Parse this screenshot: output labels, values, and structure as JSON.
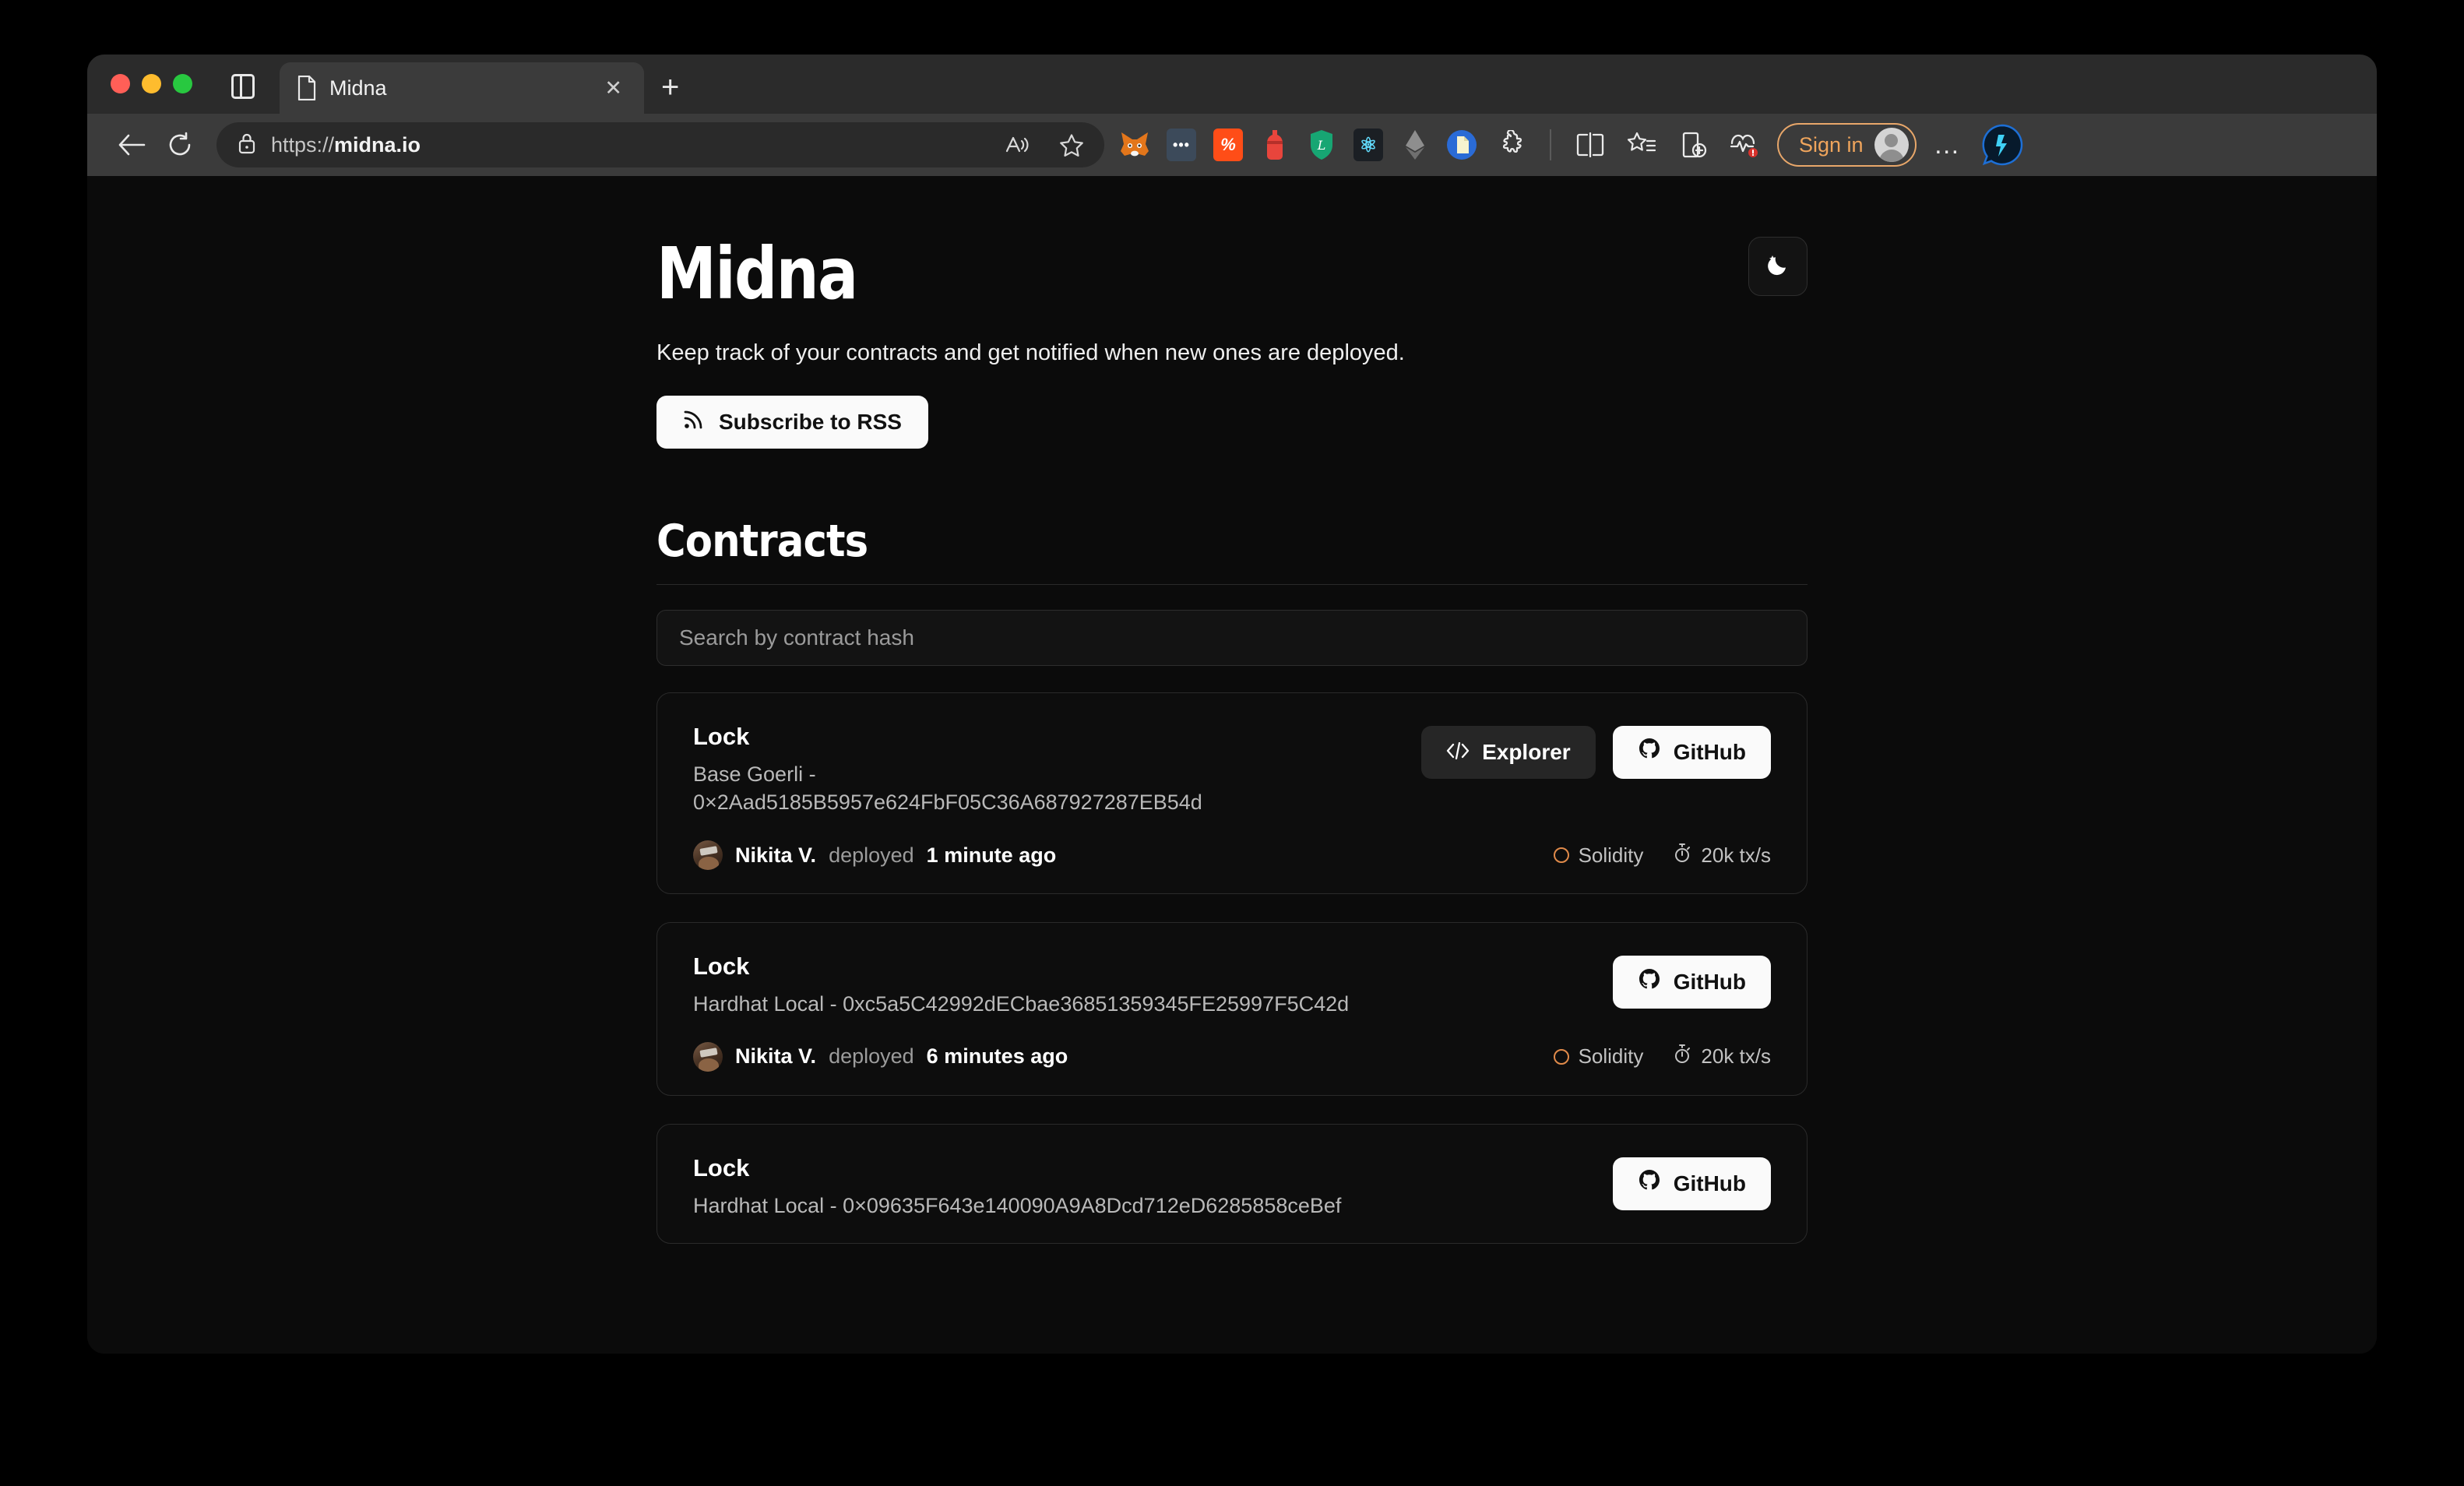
{
  "browser": {
    "tab": {
      "title": "Midna",
      "favicon": "document-icon",
      "close": "✕"
    },
    "new_tab": "+",
    "omnibox": {
      "url_prefix": "https://",
      "url_domain": "midna.io",
      "lock_icon": "lock-icon",
      "read_aloud_icon": "read-aloud-icon",
      "favorite_icon": "star-icon"
    },
    "extensions": [
      {
        "name": "metamask-icon",
        "glyph": "🦊",
        "bg": "transparent",
        "fg": "#e2761b"
      },
      {
        "name": "dots-extension-icon",
        "glyph": "•••",
        "bg": "#3c4a5a",
        "fg": "#ffffff"
      },
      {
        "name": "percent-extension-icon",
        "glyph": "%",
        "bg": "#ff4d17",
        "fg": "#ffffff"
      },
      {
        "name": "bottle-extension-icon",
        "glyph": "●",
        "bg": "transparent",
        "fg": "#e8453c"
      },
      {
        "name": "shield-extension-icon",
        "glyph": "L",
        "bg": "transparent",
        "fg": "#17a673"
      },
      {
        "name": "react-devtools-icon",
        "glyph": "⚛",
        "bg": "#1b1f24",
        "fg": "#61dafb"
      },
      {
        "name": "ethereum-extension-icon",
        "glyph": "⧫",
        "bg": "transparent",
        "fg": "#9a9a9a"
      },
      {
        "name": "blue-doc-extension-icon",
        "glyph": "◐",
        "bg": "#2a6bd6",
        "fg": "#f5f0c0"
      }
    ],
    "toolbar_icons": [
      {
        "name": "extensions-puzzle-icon"
      },
      {
        "name": "split-screen-icon"
      },
      {
        "name": "favorites-icon"
      },
      {
        "name": "collections-icon"
      },
      {
        "name": "browser-essentials-icon"
      }
    ],
    "sign_in": {
      "label": "Sign in",
      "avatar": "account-avatar"
    },
    "more_menu": "…",
    "copilot": "copilot-icon"
  },
  "page": {
    "title": "Midna",
    "tagline": "Keep track of your contracts and get notified when new ones are deployed.",
    "subscribe_button": {
      "label": "Subscribe to RSS",
      "icon": "rss-icon"
    },
    "theme_toggle": {
      "icon": "moon-stars-icon"
    },
    "contracts_heading": "Contracts",
    "search": {
      "placeholder": "Search by contract hash",
      "value": ""
    },
    "contracts": [
      {
        "name": "Lock",
        "subtitle": "Base Goerli - 0×2Aad5185B5957e624FbF05C36A687927287EB54d",
        "network": "Base Goerli",
        "hash": "0×2Aad5185B5957e624FbF05C36A687927287EB54d",
        "actions": [
          {
            "name": "explorer-button",
            "label": "Explorer",
            "icon": "code-brackets-icon",
            "style": "dark"
          },
          {
            "name": "github-button",
            "label": "GitHub",
            "icon": "github-icon",
            "style": "light"
          }
        ],
        "deployer": "Nikita V.",
        "deployed_verb": "deployed",
        "deployed_time": "1 minute ago",
        "language": "Solidity",
        "throughput": "20k tx/s"
      },
      {
        "name": "Lock",
        "subtitle": "Hardhat Local - 0xc5a5C42992dECbae36851359345FE25997F5C42d",
        "network": "Hardhat Local",
        "hash": "0xc5a5C42992dECbae36851359345FE25997F5C42d",
        "actions": [
          {
            "name": "github-button",
            "label": "GitHub",
            "icon": "github-icon",
            "style": "light"
          }
        ],
        "deployer": "Nikita V.",
        "deployed_verb": "deployed",
        "deployed_time": "6 minutes ago",
        "language": "Solidity",
        "throughput": "20k tx/s"
      },
      {
        "name": "Lock",
        "subtitle": "Hardhat Local - 0×09635F643e140090A9A8Dcd712eD6285858ceBef",
        "network": "Hardhat Local",
        "hash": "0×09635F643e140090A9A8Dcd712eD6285858ceBef",
        "actions": [
          {
            "name": "github-button",
            "label": "GitHub",
            "icon": "github-icon",
            "style": "light"
          }
        ],
        "deployer": "",
        "deployed_verb": "",
        "deployed_time": "",
        "language": "",
        "throughput": ""
      }
    ],
    "colors": {
      "page_bg": "#0b0b0b",
      "card_bg": "#0d0d0d",
      "card_border": "#2a2a2a",
      "accent_solidity": "#e08a4a",
      "button_light": "#fafafa",
      "sign_in_accent": "#f0a55c"
    }
  }
}
